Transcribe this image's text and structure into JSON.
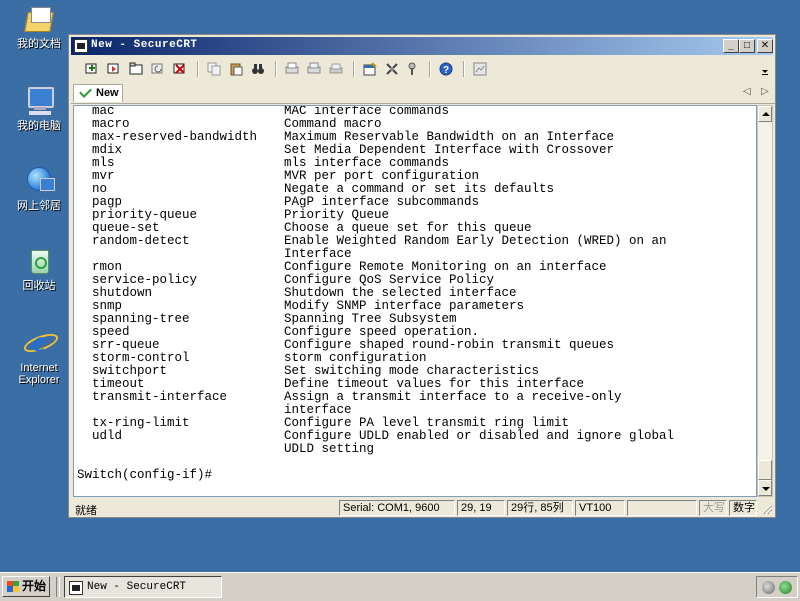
{
  "desktop": {
    "icons": [
      {
        "label": "我的文档",
        "icon": "my-documents-icon"
      },
      {
        "label": "我的电脑",
        "icon": "my-computer-icon"
      },
      {
        "label": "网上邻居",
        "icon": "network-places-icon"
      },
      {
        "label": "回收站",
        "icon": "recycle-bin-icon"
      },
      {
        "label": "Internet Explorer",
        "icon": "internet-explorer-icon"
      }
    ]
  },
  "window": {
    "title": "New - SecureCRT",
    "controls": {
      "minimize": "_",
      "maximize": "□",
      "close": "✕"
    }
  },
  "tabs": [
    {
      "label": "New"
    }
  ],
  "tabnav": {
    "prev": "◁",
    "next": "▷"
  },
  "terminal": {
    "rows": [
      {
        "cmd": "mac",
        "desc": "MAC interface commands"
      },
      {
        "cmd": "macro",
        "desc": "Command macro"
      },
      {
        "cmd": "max-reserved-bandwidth",
        "desc": "Maximum Reservable Bandwidth on an Interface"
      },
      {
        "cmd": "mdix",
        "desc": "Set Media Dependent Interface with Crossover"
      },
      {
        "cmd": "mls",
        "desc": "mls interface commands"
      },
      {
        "cmd": "mvr",
        "desc": "MVR per port configuration"
      },
      {
        "cmd": "no",
        "desc": "Negate a command or set its defaults"
      },
      {
        "cmd": "pagp",
        "desc": "PAgP interface subcommands"
      },
      {
        "cmd": "priority-queue",
        "desc": "Priority Queue"
      },
      {
        "cmd": "queue-set",
        "desc": "Choose a queue set for this queue"
      },
      {
        "cmd": "random-detect",
        "desc": "Enable Weighted Random Early Detection (WRED) on an"
      },
      {
        "cmd": "",
        "desc": "Interface"
      },
      {
        "cmd": "rmon",
        "desc": "Configure Remote Monitoring on an interface"
      },
      {
        "cmd": "service-policy",
        "desc": "Configure QoS Service Policy"
      },
      {
        "cmd": "shutdown",
        "desc": "Shutdown the selected interface"
      },
      {
        "cmd": "snmp",
        "desc": "Modify SNMP interface parameters"
      },
      {
        "cmd": "spanning-tree",
        "desc": "Spanning Tree Subsystem"
      },
      {
        "cmd": "speed",
        "desc": "Configure speed operation."
      },
      {
        "cmd": "srr-queue",
        "desc": "Configure shaped round-robin transmit queues"
      },
      {
        "cmd": "storm-control",
        "desc": "storm configuration"
      },
      {
        "cmd": "switchport",
        "desc": "Set switching mode characteristics"
      },
      {
        "cmd": "timeout",
        "desc": "Define timeout values for this interface"
      },
      {
        "cmd": "transmit-interface",
        "desc": "Assign a transmit interface to a receive-only"
      },
      {
        "cmd": "",
        "desc": "interface"
      },
      {
        "cmd": "tx-ring-limit",
        "desc": "Configure PA level transmit ring limit"
      },
      {
        "cmd": "udld",
        "desc": "Configure UDLD enabled or disabled and ignore global"
      },
      {
        "cmd": "",
        "desc": "UDLD setting"
      }
    ],
    "prompt": "Switch(config-if)#"
  },
  "statusbar": {
    "ready": "就绪",
    "serial": "Serial: COM1, 9600",
    "cursor": "29, 19",
    "size": "29行, 85列",
    "emulation": "VT100",
    "caps": "大写",
    "num": "数字"
  },
  "taskbar": {
    "start_label": "开始",
    "task_label": "New - SecureCRT"
  },
  "colors": {
    "desktop": "#3a6ea5",
    "titlebar_start": "#0a246a",
    "titlebar_end": "#a6caf0",
    "window_face": "#ece9d8"
  }
}
